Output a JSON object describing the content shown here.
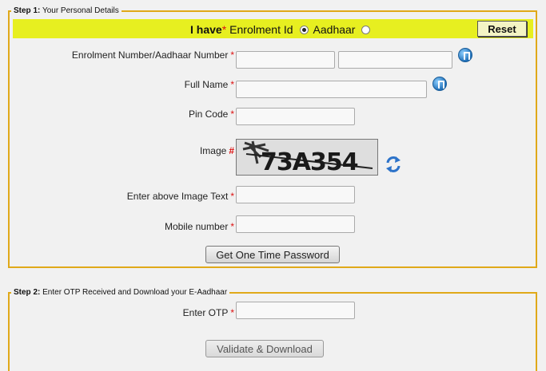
{
  "step1": {
    "legend_bold": "Step 1:",
    "legend_text": " Your Personal Details"
  },
  "selector": {
    "i_have": "I have",
    "required_mark": "*",
    "option1_label": "Enrolment Id",
    "option2_label": "Aadhaar",
    "selected": "Enrolment Id",
    "reset_label": "Reset"
  },
  "fields": {
    "enrolment_label": "Enrolment Number/Aadhaar Number",
    "fullname_label": "Full Name",
    "pincode_label": "Pin Code",
    "image_label": "Image",
    "image_required": "#",
    "image_text_label": "Enter above Image Text",
    "mobile_label": "Mobile number",
    "required": "*"
  },
  "captcha": {
    "text": "73A354"
  },
  "icons": {
    "info": "info-icon",
    "refresh": "refresh-icon",
    "accent_border": "#e0a919",
    "bar_color": "#e7ef20"
  },
  "otp_button_label": "Get One Time Password",
  "step2": {
    "legend_bold": "Step 2:",
    "legend_text": " Enter OTP Received and Download your E-Aadhaar",
    "otp_label": "Enter OTP",
    "download_label": "Validate & Download"
  }
}
